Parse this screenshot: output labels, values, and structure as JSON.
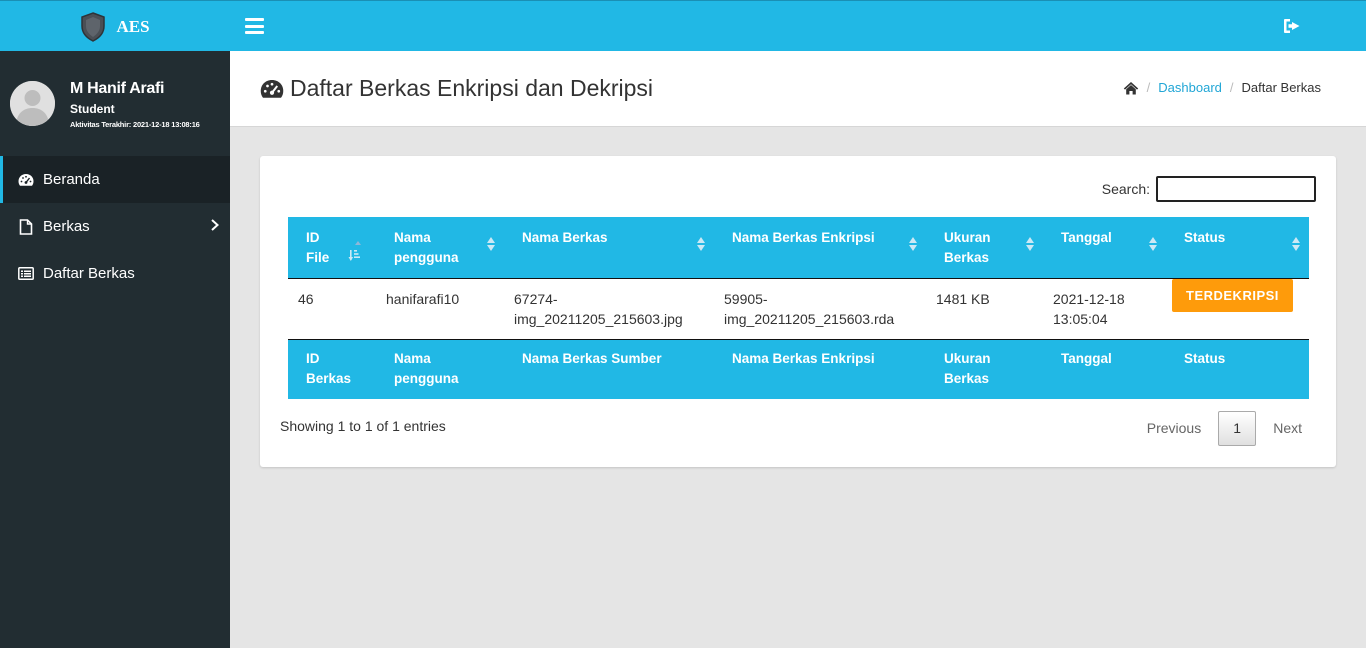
{
  "app": {
    "brand": "AES"
  },
  "user": {
    "name": "M Hanif Arafi",
    "role": "Student",
    "last_activity": "Aktivitas Terakhir: 2021-12-18 13:08:16"
  },
  "sidebar": {
    "items": [
      {
        "label": "Beranda",
        "icon": "dashboard-icon",
        "active": true
      },
      {
        "label": "Berkas",
        "icon": "file-icon",
        "has_submenu": true
      },
      {
        "label": "Daftar Berkas",
        "icon": "list-icon"
      }
    ]
  },
  "header": {
    "title": "Daftar Berkas Enkripsi dan Dekripsi",
    "breadcrumb": {
      "link": "Dashboard",
      "current": "Daftar Berkas"
    }
  },
  "search": {
    "label": "Search:",
    "value": ""
  },
  "table": {
    "columns": [
      {
        "line1": "ID",
        "line2": "File"
      },
      {
        "line1": "Nama",
        "line2": "pengguna"
      },
      {
        "line1": "Nama Berkas",
        "line2": ""
      },
      {
        "line1": "Nama Berkas Enkripsi",
        "line2": ""
      },
      {
        "line1": "Ukuran",
        "line2": "Berkas"
      },
      {
        "line1": "Tanggal",
        "line2": ""
      },
      {
        "line1": "Status",
        "line2": ""
      }
    ],
    "footer_columns": [
      {
        "line1": "ID",
        "line2": "Berkas"
      },
      {
        "line1": "Nama",
        "line2": "pengguna"
      },
      {
        "line1": "Nama Berkas Sumber",
        "line2": ""
      },
      {
        "line1": "Nama Berkas Enkripsi",
        "line2": ""
      },
      {
        "line1": "Ukuran",
        "line2": "Berkas"
      },
      {
        "line1": "Tanggal",
        "line2": ""
      },
      {
        "line1": "Status",
        "line2": ""
      }
    ],
    "rows": [
      {
        "id": "46",
        "user": "hanifarafi10",
        "file_a": "67274-",
        "file_b": "img_20211205_215603.jpg",
        "enc_a": "59905-",
        "enc_b": "img_20211205_215603.rda",
        "size": "1481 KB",
        "date_a": "2021-12-18",
        "date_b": "13:05:04",
        "status": "TERDEKRIPSI"
      }
    ]
  },
  "pagination": {
    "info": "Showing 1 to 1 of 1 entries",
    "previous": "Previous",
    "current": "1",
    "next": "Next"
  },
  "colors": {
    "primary": "#21b8e5",
    "sidebar": "#222d32",
    "status": "#fe9b0b"
  }
}
